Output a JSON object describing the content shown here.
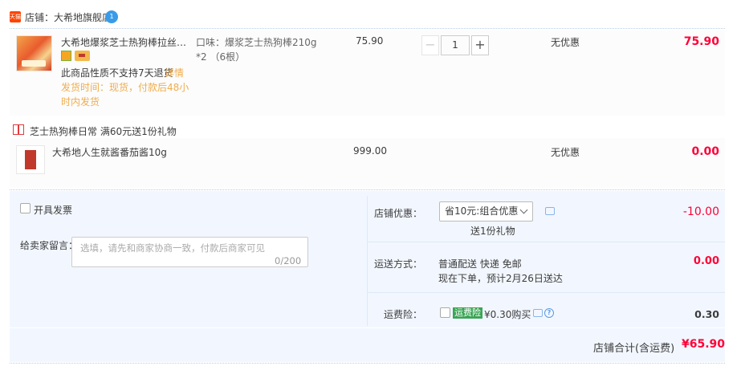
{
  "shop": {
    "logo_text": "天猫",
    "label": "店铺：大希地旗舰店",
    "badge": "1"
  },
  "item": {
    "title": "大希地爆浆芝士热狗棒拉丝香肠...",
    "return_note": "此商品性质不支持7天退货",
    "detail_link": "详情",
    "ship_note": "发货时间：现货，付款后48小时内发货",
    "flavor": "口味：爆浆芝士热狗棒210g *2 （6根）",
    "price": "75.90",
    "qty_minus": "−",
    "qty": "1",
    "qty_plus": "+",
    "discount": "无优惠",
    "subtotal": "75.90"
  },
  "gift": {
    "promo_label": "芝士热狗棒日常   满60元送1份礼物",
    "title": "大希地人生就酱番茄酱10g",
    "price": "999.00",
    "discount": "无优惠",
    "subtotal": "0.00"
  },
  "extras": {
    "invoice_label": "开具发票",
    "message_label": "给卖家留言：",
    "message_placeholder": "选填，请先和商家协商一致，付款后商家可见",
    "message_count": "0/200",
    "shop_discount_label": "店铺优惠：",
    "shop_discount_select": "省10元:组合优惠",
    "shop_discount_gift": "送1份礼物",
    "shop_discount_value": "-10.00",
    "shipping_label": "运送方式：",
    "shipping_line1": "普通配送 快递 免邮",
    "shipping_line2": "现在下单，预计2月26日送达",
    "shipping_value": "0.00",
    "insurance_label": "运费险：",
    "insurance_badge": "运费险",
    "insurance_price": "¥0.30购买",
    "insurance_value": "0.30",
    "help_icon_glyph": "?"
  },
  "total": {
    "label": "店铺合计(含运费)",
    "value": "¥65.90"
  },
  "colors": {
    "price_red": "#ff0036",
    "accent_orange": "#f0ad4e",
    "panel_blue": "#f2f7ff"
  }
}
